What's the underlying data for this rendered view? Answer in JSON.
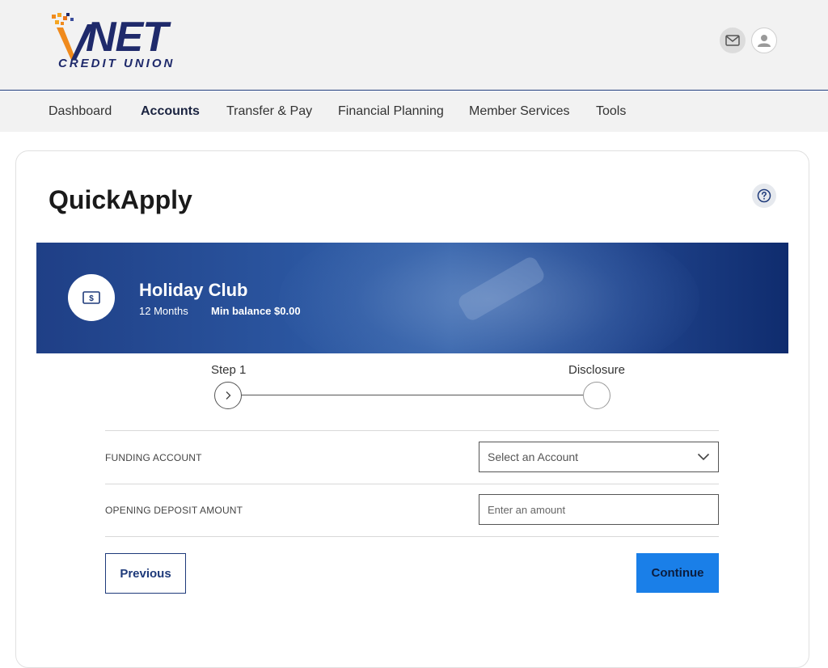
{
  "brand": {
    "name": "NET",
    "sub": "CREDIT UNION"
  },
  "nav": {
    "items": [
      "Dashboard",
      "Accounts",
      "Transfer & Pay",
      "Financial Planning",
      "Member Services",
      "Tools"
    ],
    "active": "Accounts"
  },
  "page": {
    "title": "QuickApply"
  },
  "account": {
    "name": "Holiday Club",
    "term": "12 Months",
    "min_balance": "Min balance $0.00"
  },
  "steps": {
    "step1": "Step 1",
    "step2": "Disclosure"
  },
  "form": {
    "funding_label": "FUNDING ACCOUNT",
    "funding_value": "Select an Account",
    "deposit_label": "OPENING DEPOSIT AMOUNT",
    "deposit_placeholder": "Enter an amount"
  },
  "buttons": {
    "previous": "Previous",
    "continue": "Continue"
  },
  "colors": {
    "brand_navy": "#1f2a6b",
    "brand_orange": "#f08a1c",
    "continue_blue": "#1a7fe8",
    "banner_blue": "#2b56a0"
  }
}
